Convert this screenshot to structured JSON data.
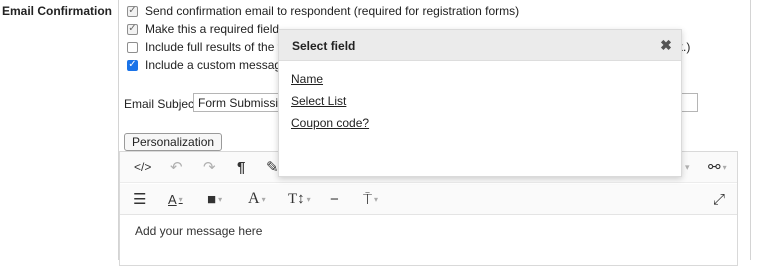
{
  "section": {
    "label": "Email Confirmation"
  },
  "options": [
    {
      "label": "Send confirmation email to respondent (required for registration forms)",
      "state": "checked"
    },
    {
      "label": "Make this a required field",
      "state": "checked"
    },
    {
      "label": "Include full results of the form",
      "state": "unchecked"
    },
    {
      "label": "Include a custom message",
      "state": "checked"
    }
  ],
  "trailing_text": "k.)",
  "email_subject": {
    "label": "Email Subject",
    "value": "Form Submission"
  },
  "personalization_button": "Personalization",
  "editor": {
    "placeholder": "Add your message here",
    "toolbar_row1": [
      "code-view-icon",
      "undo-icon",
      "redo-icon",
      "paragraph-icon",
      "brush-icon",
      "link-icon"
    ],
    "toolbar_row2": [
      "align-left-icon",
      "font-color-icon",
      "background-color-icon",
      "font-family-icon",
      "font-size-icon",
      "horizontal-line-icon",
      "paragraph-format-icon",
      "fullscreen-icon"
    ]
  },
  "dialog": {
    "title": "Select field",
    "fields": [
      "Name",
      "Select List",
      "Coupon code?"
    ]
  },
  "colors": {
    "checkbox_blue": "#1a73e8",
    "dialog_header": "#ebebeb"
  }
}
